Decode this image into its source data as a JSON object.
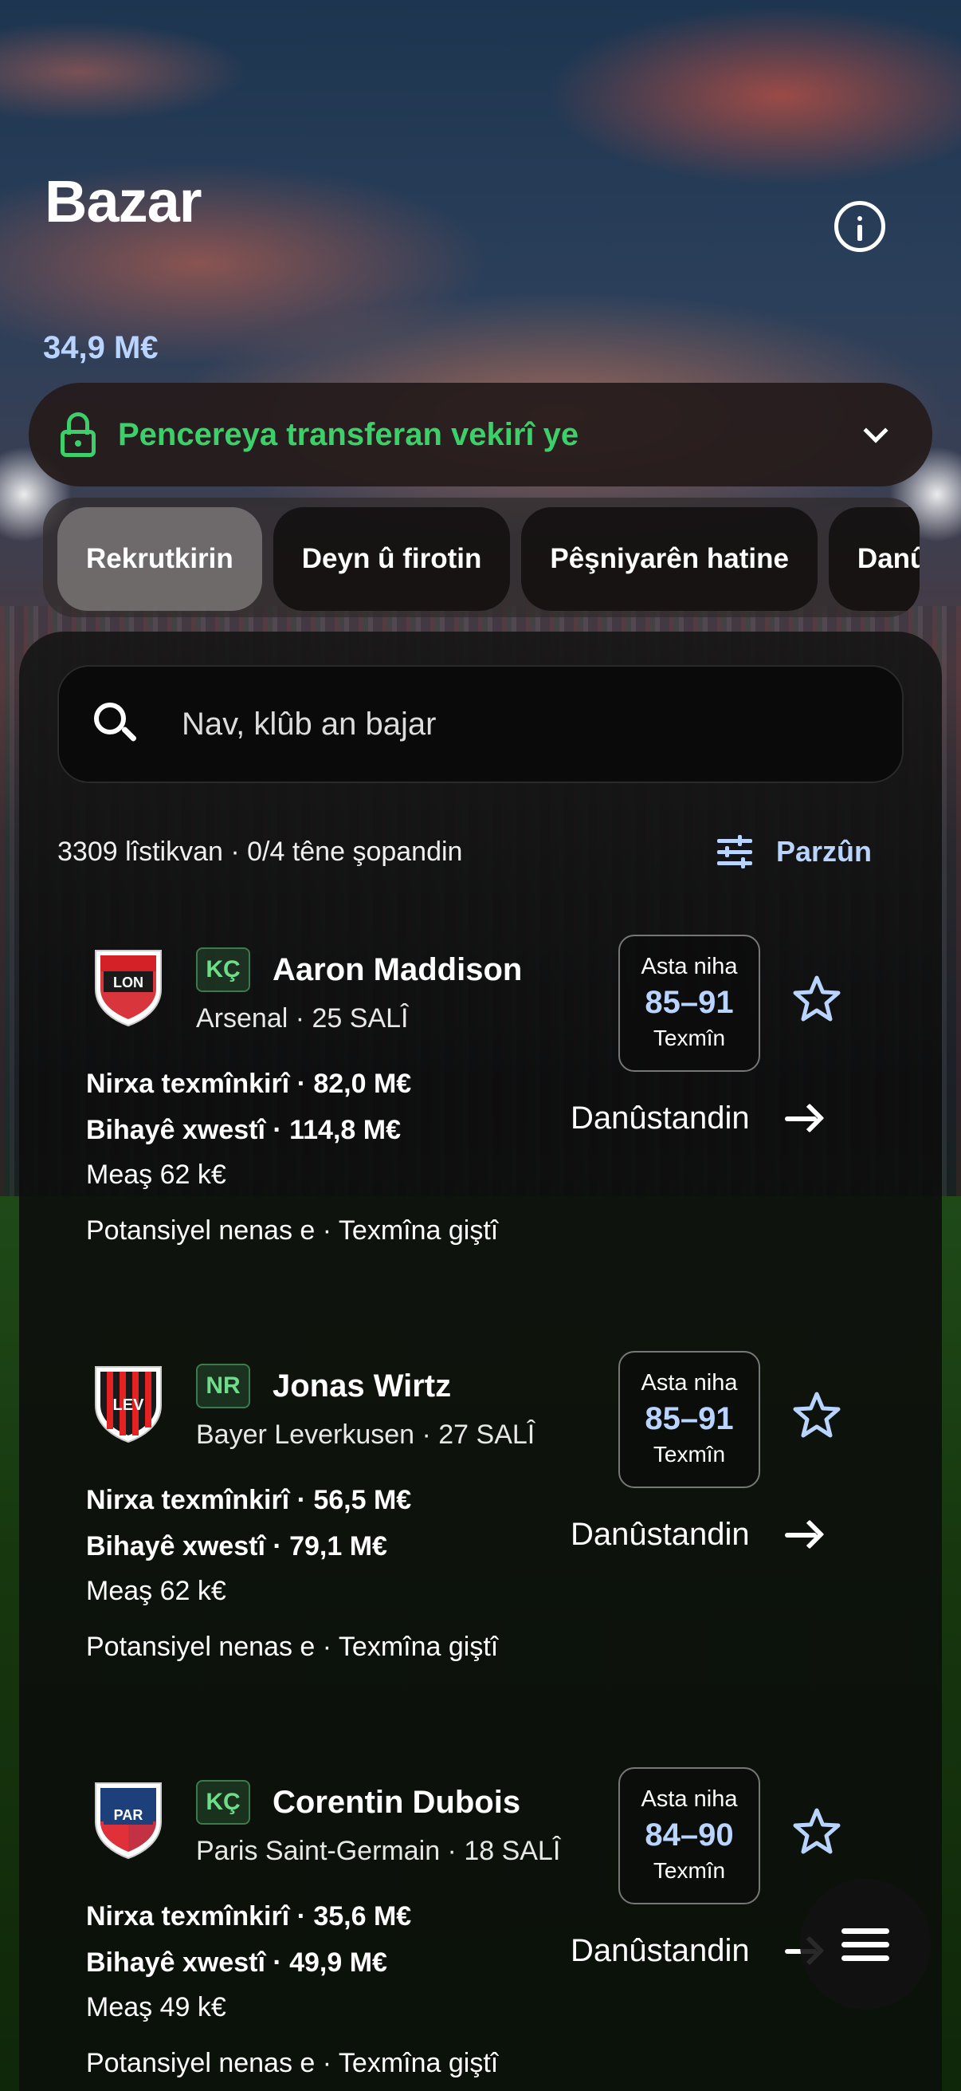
{
  "header": {
    "title": "Bazar",
    "budget": "34,9 M€"
  },
  "window": {
    "label": "Pencereya transferan vekirî ye"
  },
  "tabs": [
    {
      "label": "Rekrutkirin",
      "active": true
    },
    {
      "label": "Deyn û firotin",
      "active": false
    },
    {
      "label": "Pêşniyarên hatine",
      "active": false
    },
    {
      "label": "Danûstandin",
      "active": false
    }
  ],
  "search": {
    "placeholder": "Nav, klûb an bajar"
  },
  "list_meta": {
    "summary": "3309 lîstikvan · 0/4 têne şopandin",
    "filter_label": "Parzûn"
  },
  "players": [
    {
      "crest": "LON",
      "crest_colors": {
        "primary": "#d42027",
        "secondary": "#ffffff",
        "accent": "#1a1a1a"
      },
      "position": "KÇ",
      "name": "Aaron Maddison",
      "club_age": "Arsenal · 25 SALÎ",
      "rating_top": "Asta niha",
      "rating": "85–91",
      "rating_bottom": "Texmîn",
      "fee": "Nirxa texmînkirî · 82,0 M€",
      "ask": "Bihayê xwestî · 114,8 M€",
      "wage": "Meaş 62 k€",
      "potential": "Potansiyel nenas e · Texmîna giştî",
      "action": "Danûstandin"
    },
    {
      "crest": "LEV",
      "crest_colors": {
        "primary": "#e32221",
        "secondary": "#1a1a1a",
        "accent": "#ffffff"
      },
      "position": "NR",
      "name": "Jonas Wirtz",
      "club_age": "Bayer Leverkusen · 27 SALÎ",
      "rating_top": "Asta niha",
      "rating": "85–91",
      "rating_bottom": "Texmîn",
      "fee": "Nirxa texmînkirî · 56,5 M€",
      "ask": "Bihayê xwestî · 79,1 M€",
      "wage": "Meaş 62 k€",
      "potential": "Potansiyel nenas e · Texmîna giştî",
      "action": "Danûstandin"
    },
    {
      "crest": "PAR",
      "crest_colors": {
        "primary": "#1d3f7a",
        "secondary": "#e0303a",
        "accent": "#ffffff"
      },
      "position": "KÇ",
      "name": "Corentin Dubois",
      "club_age": "Paris Saint-Germain · 18 SALÎ",
      "rating_top": "Asta niha",
      "rating": "84–90",
      "rating_bottom": "Texmîn",
      "fee": "Nirxa texmînkirî · 35,6 M€",
      "ask": "Bihayê xwestî · 49,9 M€",
      "wage": "Meaş 49 k€",
      "potential": "Potansiyel nenas e · Texmîna giştî",
      "action": "Danûstandin"
    }
  ],
  "colors": {
    "accent_blue": "#b9d4ff",
    "accent_green": "#3ccf6a"
  }
}
